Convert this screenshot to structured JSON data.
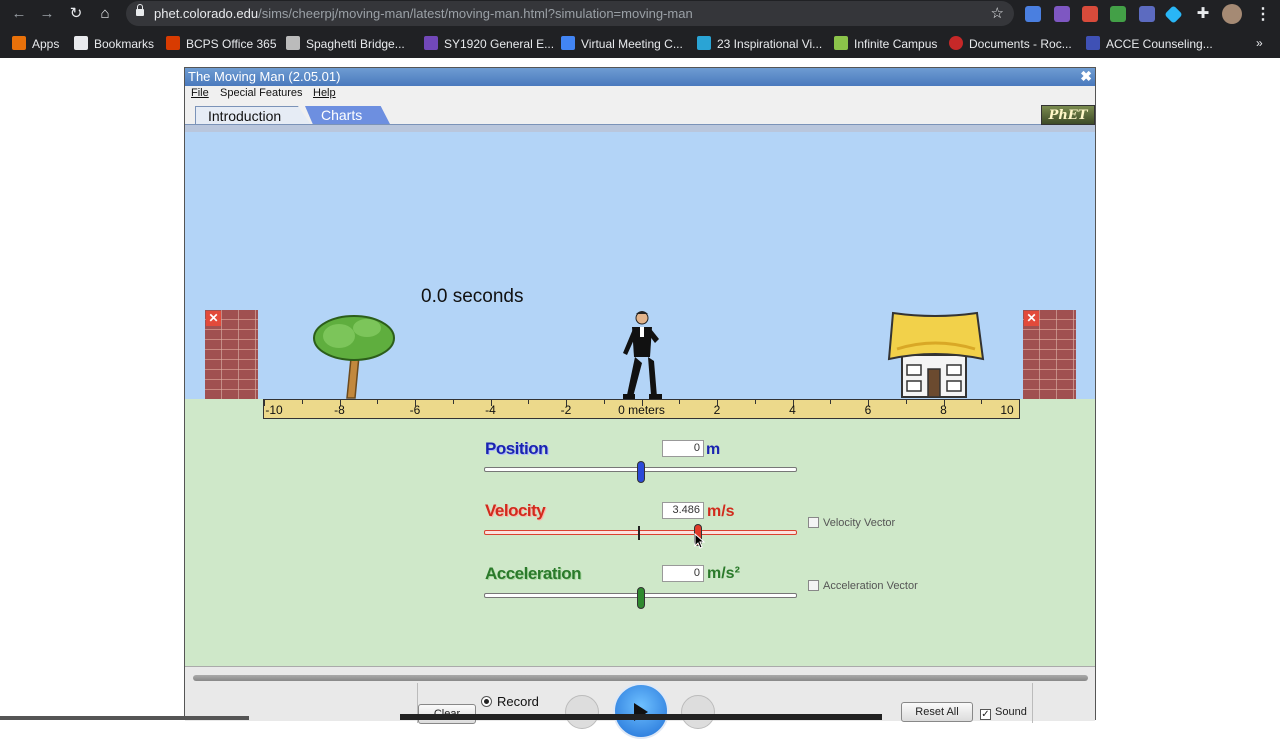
{
  "browser": {
    "url_domain": "phet.colorado.edu",
    "url_path": "/sims/cheerpj/moving-man/latest/moving-man.html?simulation=moving-man",
    "bookmarks": [
      {
        "label": "Apps",
        "color": "#e8710a"
      },
      {
        "label": "Bookmarks",
        "color": "#e8eaed"
      },
      {
        "label": "BCPS Office 365",
        "color": "#d83b01"
      },
      {
        "label": "Spaghetti Bridge...",
        "color": "#bbbbbb"
      },
      {
        "label": "SY1920 General E...",
        "color": "#7248b9"
      },
      {
        "label": "Virtual Meeting C...",
        "color": "#4285f4"
      },
      {
        "label": "23 Inspirational Vi...",
        "color": "#2aa4d5"
      },
      {
        "label": "Infinite Campus",
        "color": "#8bc34a"
      },
      {
        "label": "Documents - Roc...",
        "color": "#c62828"
      },
      {
        "label": "ACCE Counseling...",
        "color": "#3f51b5"
      }
    ],
    "more": "»"
  },
  "sim": {
    "title": "The Moving Man (2.05.01)",
    "menu": [
      "File",
      "Special Features",
      "Help"
    ],
    "tabs": [
      "Introduction",
      "Charts"
    ],
    "logo": "PhET",
    "clock": "0.0 seconds",
    "ruler": {
      "labels": [
        "-10",
        "-8",
        "-6",
        "-4",
        "-2",
        "0 meters",
        "2",
        "4",
        "6",
        "8",
        "10"
      ]
    },
    "position": {
      "label": "Position",
      "value": "0",
      "unit": "m",
      "level": 0.5
    },
    "velocity": {
      "label": "Velocity",
      "value": "3.486",
      "unit": "m/s",
      "level": 0.683,
      "vector_label": "Velocity Vector"
    },
    "acceleration": {
      "label": "Acceleration",
      "value": "0",
      "unit": "m/s²",
      "level": 0.5,
      "vector_label": "Acceleration Vector"
    },
    "controls": {
      "clear": "Clear",
      "record": "Record",
      "reset": "Reset All",
      "sound": "Sound"
    }
  }
}
